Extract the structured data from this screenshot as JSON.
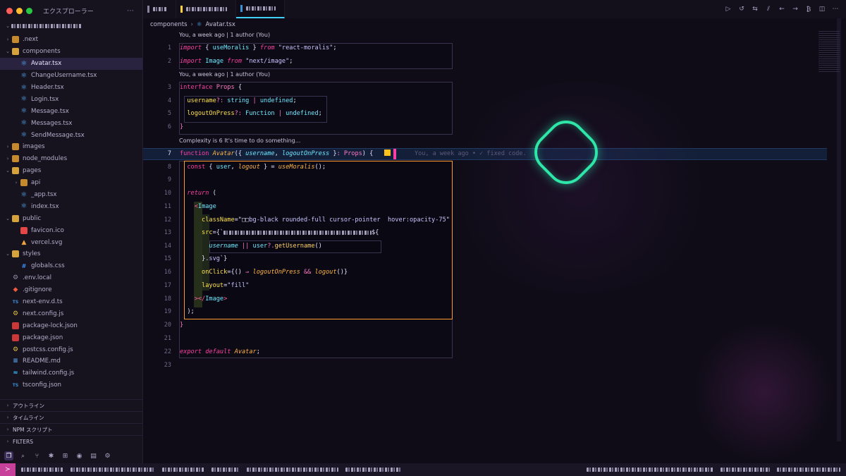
{
  "window": {
    "traffic_lights": [
      "#ff5f57",
      "#febc2e",
      "#28c840"
    ]
  },
  "sidebar": {
    "title": "エクスプローラー",
    "more_icon": "ellipsis-icon",
    "tree": [
      {
        "label": ".next",
        "depth": 1,
        "kind": "folder",
        "state": "closed",
        "icon": "folder-icon"
      },
      {
        "label": "components",
        "depth": 1,
        "kind": "folder",
        "state": "open",
        "icon": "folder-icon"
      },
      {
        "label": "Avatar.tsx",
        "depth": 2,
        "kind": "file",
        "icon": "react-icon",
        "active": true
      },
      {
        "label": "ChangeUsername.tsx",
        "depth": 2,
        "kind": "file",
        "icon": "react-icon"
      },
      {
        "label": "Header.tsx",
        "depth": 2,
        "kind": "file",
        "icon": "react-icon"
      },
      {
        "label": "Login.tsx",
        "depth": 2,
        "kind": "file",
        "icon": "react-icon"
      },
      {
        "label": "Message.tsx",
        "depth": 2,
        "kind": "file",
        "icon": "react-icon"
      },
      {
        "label": "Messages.tsx",
        "depth": 2,
        "kind": "file",
        "icon": "react-icon"
      },
      {
        "label": "SendMessage.tsx",
        "depth": 2,
        "kind": "file",
        "icon": "react-icon"
      },
      {
        "label": "images",
        "depth": 1,
        "kind": "folder",
        "state": "closed",
        "icon": "folder-icon"
      },
      {
        "label": "node_modules",
        "depth": 1,
        "kind": "folder",
        "state": "closed",
        "icon": "folder-icon"
      },
      {
        "label": "pages",
        "depth": 1,
        "kind": "folder",
        "state": "open",
        "icon": "folder-icon"
      },
      {
        "label": "api",
        "depth": 2,
        "kind": "folder",
        "state": "closed",
        "icon": "folder-icon"
      },
      {
        "label": "_app.tsx",
        "depth": 2,
        "kind": "file",
        "icon": "react-icon"
      },
      {
        "label": "index.tsx",
        "depth": 2,
        "kind": "file",
        "icon": "react-icon"
      },
      {
        "label": "public",
        "depth": 1,
        "kind": "folder",
        "state": "open",
        "icon": "folder-icon"
      },
      {
        "label": "favicon.ico",
        "depth": 2,
        "kind": "file",
        "icon": "favicon-icon"
      },
      {
        "label": "vercel.svg",
        "depth": 2,
        "kind": "file",
        "icon": "svg-icon"
      },
      {
        "label": "styles",
        "depth": 1,
        "kind": "folder",
        "state": "open",
        "icon": "folder-icon"
      },
      {
        "label": "globals.css",
        "depth": 2,
        "kind": "file",
        "icon": "css-icon"
      },
      {
        "label": ".env.local",
        "depth": 1,
        "kind": "file",
        "icon": "gear-icon"
      },
      {
        "label": ".gitignore",
        "depth": 1,
        "kind": "file",
        "icon": "git-icon"
      },
      {
        "label": "next-env.d.ts",
        "depth": 1,
        "kind": "file",
        "icon": "typescript-icon"
      },
      {
        "label": "next.config.js",
        "depth": 1,
        "kind": "file",
        "icon": "javascript-icon"
      },
      {
        "label": "package-lock.json",
        "depth": 1,
        "kind": "file",
        "icon": "npm-icon"
      },
      {
        "label": "package.json",
        "depth": 1,
        "kind": "file",
        "icon": "npm-icon"
      },
      {
        "label": "postcss.config.js",
        "depth": 1,
        "kind": "file",
        "icon": "javascript-icon"
      },
      {
        "label": "README.md",
        "depth": 1,
        "kind": "file",
        "icon": "markdown-icon"
      },
      {
        "label": "tailwind.config.js",
        "depth": 1,
        "kind": "file",
        "icon": "tailwind-icon"
      },
      {
        "label": "tsconfig.json",
        "depth": 1,
        "kind": "file",
        "icon": "typescript-icon"
      }
    ],
    "panels": [
      "アウトライン",
      "タイムライン",
      "NPM スクリプト",
      "FILTERS"
    ],
    "activity_icons": [
      "explorer-icon",
      "search-icon",
      "source-control-icon",
      "debug-icon",
      "extensions-icon",
      "github-icon",
      "docker-icon",
      "settings-sync-icon"
    ]
  },
  "tabs": [
    {
      "icon": "file-icon",
      "color": "#8a84a3",
      "active": false
    },
    {
      "icon": "file-icon",
      "color": "#ffd33d",
      "active": false
    },
    {
      "icon": "react-file-icon",
      "color": "#3a8fd6",
      "active": true
    }
  ],
  "toolbar_icons": [
    "run-icon",
    "history-icon",
    "compare-icon",
    "git-lens-icon",
    "previous-change-icon",
    "next-change-icon",
    "bitcoin-icon",
    "split-editor-icon",
    "more-actions-icon"
  ],
  "editor": {
    "breadcrumb": {
      "folder": "components",
      "file": "Avatar.tsx"
    },
    "codelens": {
      "blame1": "You, a week ago | 1 author (You)",
      "blame2": "You, a week ago | 1 author (You)",
      "complexity": "Complexity is 6 It's time to do something..."
    },
    "current_line": 7,
    "inline_blame": "You, a week ago • ✓ fixed code.",
    "line_numbers": [
      1,
      2,
      3,
      4,
      5,
      6,
      7,
      8,
      9,
      10,
      11,
      12,
      13,
      14,
      15,
      16,
      17,
      18,
      19,
      20,
      21,
      22,
      23
    ],
    "tokens": {
      "import": "import",
      "from": "from",
      "useMoralis": "useMoralis",
      "react_moralis": "\"react-moralis\"",
      "Image": "Image",
      "next_image": "\"next/image\"",
      "interface": "interface",
      "Props": "Props",
      "username": "username",
      "logoutOnPress": "logoutOnPress",
      "string": "string",
      "undefined": "undefined",
      "Function": "Function",
      "function": "function",
      "Avatar": "Avatar",
      "const": "const",
      "user": "user",
      "logout": "logout",
      "return": "return",
      "className": "className",
      "class_value": "bg-black rounded-full cursor-pointer  hover:opacity-75",
      "src": "src",
      "getUsername": "getUsername",
      "svg": ".svg",
      "onClick": "onClick",
      "layout": "layout",
      "fill": "\"fill\"",
      "export": "export",
      "default": "default"
    }
  },
  "status_bar": {
    "remote_icon": "remote-icon"
  }
}
